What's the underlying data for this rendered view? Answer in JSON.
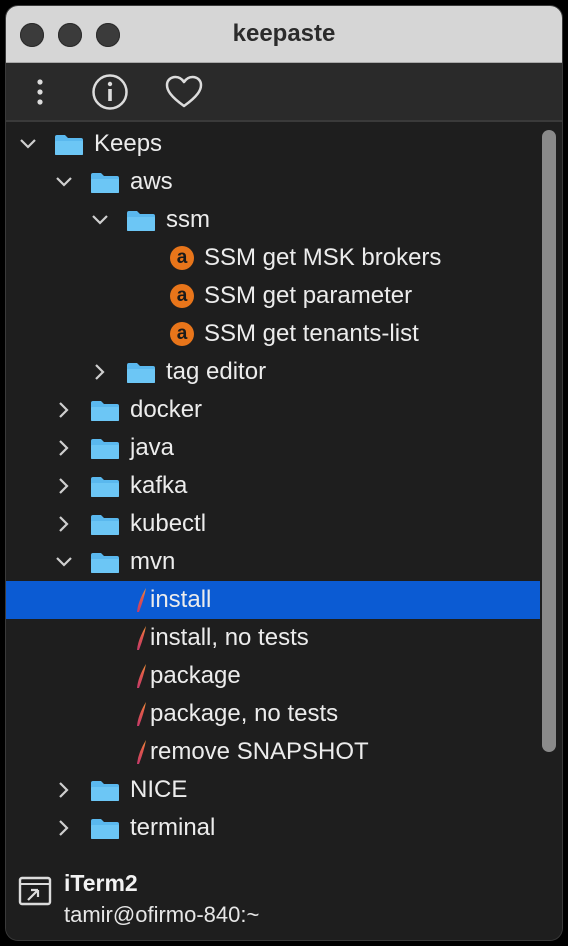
{
  "window": {
    "title": "keepaste"
  },
  "toolbar": {
    "items": [
      {
        "icon": "more-vertical-icon"
      },
      {
        "icon": "info-icon"
      },
      {
        "icon": "heart-icon"
      }
    ]
  },
  "colors": {
    "selection": "#0b5bd3",
    "folder": "#5ab8ee",
    "badge": "#e8751a"
  },
  "tree": {
    "rows": [
      {
        "label": "Keeps",
        "depth": 0,
        "kind": "folder",
        "expanded": true
      },
      {
        "label": "aws",
        "depth": 1,
        "kind": "folder",
        "expanded": true
      },
      {
        "label": "ssm",
        "depth": 2,
        "kind": "folder",
        "expanded": true
      },
      {
        "label": "SSM get MSK brokers",
        "depth": 3,
        "kind": "keep-a"
      },
      {
        "label": "SSM get parameter",
        "depth": 3,
        "kind": "keep-a"
      },
      {
        "label": "SSM get tenants-list",
        "depth": 3,
        "kind": "keep-a"
      },
      {
        "label": "tag editor",
        "depth": 2,
        "kind": "folder",
        "expanded": false
      },
      {
        "label": "docker",
        "depth": 1,
        "kind": "folder",
        "expanded": false
      },
      {
        "label": "java",
        "depth": 1,
        "kind": "folder",
        "expanded": false
      },
      {
        "label": "kafka",
        "depth": 1,
        "kind": "folder",
        "expanded": false
      },
      {
        "label": "kubectl",
        "depth": 1,
        "kind": "folder",
        "expanded": false
      },
      {
        "label": "mvn",
        "depth": 1,
        "kind": "folder",
        "expanded": true
      },
      {
        "label": "install",
        "depth": 2,
        "kind": "keep-quill",
        "selected": true
      },
      {
        "label": "install, no tests",
        "depth": 2,
        "kind": "keep-quill"
      },
      {
        "label": "package",
        "depth": 2,
        "kind": "keep-quill"
      },
      {
        "label": "package, no tests",
        "depth": 2,
        "kind": "keep-quill"
      },
      {
        "label": "remove SNAPSHOT",
        "depth": 2,
        "kind": "keep-quill"
      },
      {
        "label": "NICE",
        "depth": 1,
        "kind": "folder",
        "expanded": false
      },
      {
        "label": "terminal",
        "depth": 1,
        "kind": "folder",
        "expanded": false
      }
    ]
  },
  "footer": {
    "app_name": "iTerm2",
    "app_subtitle": "tamir@ofirmo-840:~"
  }
}
